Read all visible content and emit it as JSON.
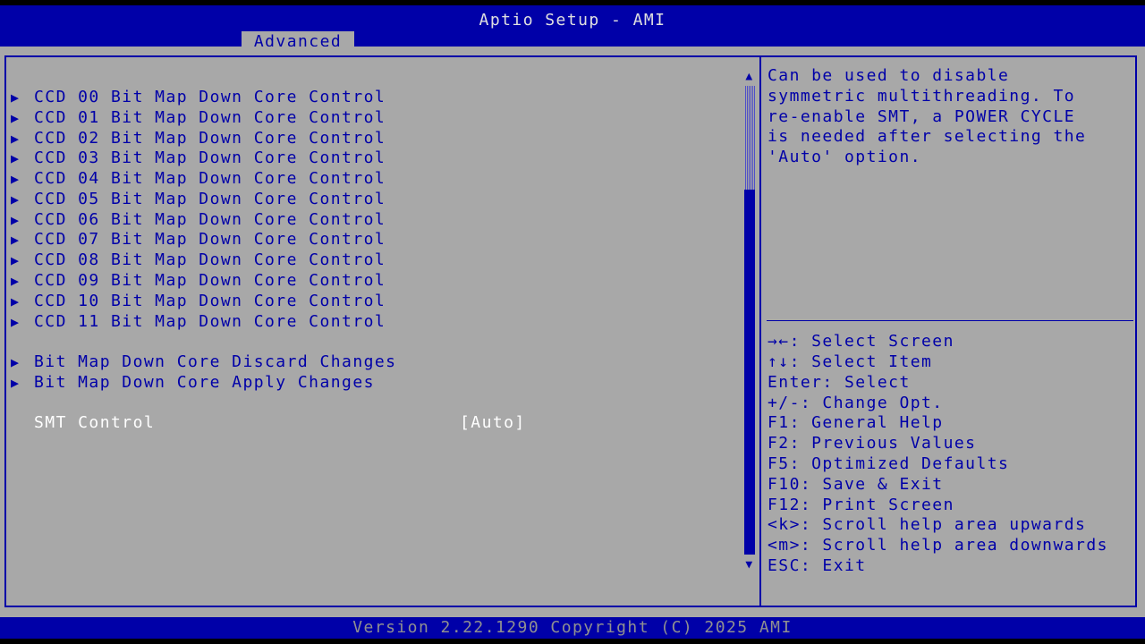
{
  "window": {
    "title": "Aptio Setup - AMI",
    "active_tab": "Advanced"
  },
  "menu_items": [
    {
      "label": "CCD 00 Bit Map Down Core Control"
    },
    {
      "label": "CCD 01 Bit Map Down Core Control"
    },
    {
      "label": "CCD 02 Bit Map Down Core Control"
    },
    {
      "label": "CCD 03 Bit Map Down Core Control"
    },
    {
      "label": "CCD 04 Bit Map Down Core Control"
    },
    {
      "label": "CCD 05 Bit Map Down Core Control"
    },
    {
      "label": "CCD 06 Bit Map Down Core Control"
    },
    {
      "label": "CCD 07 Bit Map Down Core Control"
    },
    {
      "label": "CCD 08 Bit Map Down Core Control"
    },
    {
      "label": "CCD 09 Bit Map Down Core Control"
    },
    {
      "label": "CCD 10 Bit Map Down Core Control"
    },
    {
      "label": "CCD 11 Bit Map Down Core Control"
    }
  ],
  "actions": [
    {
      "label": "Bit Map Down Core Discard Changes"
    },
    {
      "label": "Bit Map Down Core Apply Changes"
    }
  ],
  "setting": {
    "label": "SMT Control",
    "value": "[Auto]"
  },
  "help": {
    "lines": [
      "Can be used to disable",
      "symmetric multithreading. To",
      "re-enable SMT, a POWER CYCLE",
      "is needed after selecting the",
      "'Auto' option."
    ]
  },
  "key_help": [
    "→←: Select Screen",
    "↑↓: Select Item",
    "Enter: Select",
    "+/-: Change Opt.",
    "F1: General Help",
    "F2: Previous Values",
    "F5: Optimized Defaults",
    "F10: Save & Exit",
    "F12: Print Screen",
    "<k>: Scroll help area upwards",
    "<m>: Scroll help area downwards",
    "ESC: Exit"
  ],
  "footer": {
    "version": "Version 2.22.1290 Copyright (C) 2025 AMI"
  },
  "icons": {
    "submenu_arrow": "▶",
    "scroll_up": "▲",
    "scroll_down": "▼"
  },
  "colors": {
    "background": "#a8a8a8",
    "accent_blue": "#0000a8",
    "highlight_text": "#ffffff"
  }
}
